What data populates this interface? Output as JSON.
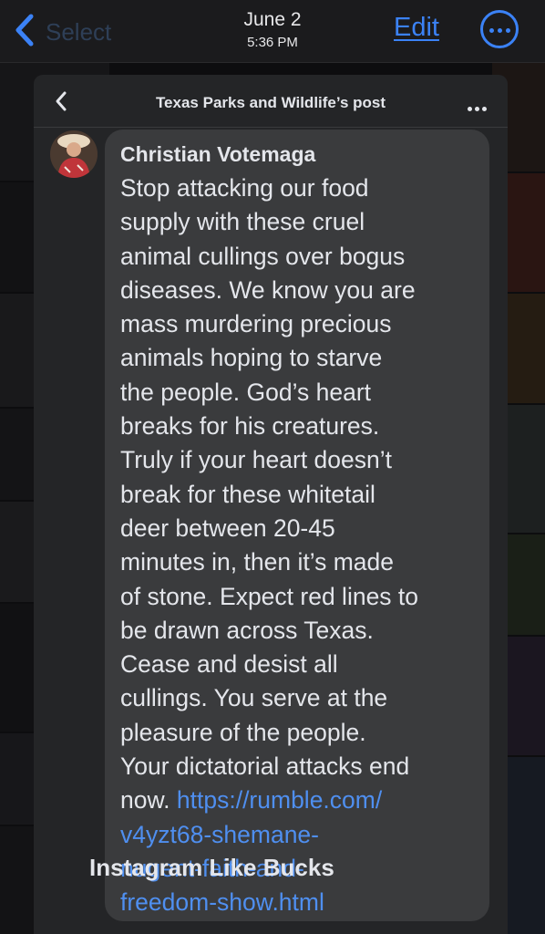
{
  "topbar": {
    "back_label": "Select",
    "date": "June 2",
    "time": "5:36 PM",
    "edit_label": "Edit",
    "more_icon": "more-circle-icon"
  },
  "post": {
    "header_title": "Texas Parks and Wildlife’s post",
    "back_icon": "chevron-left-icon",
    "menu_icon": "ellipsis-icon"
  },
  "comment": {
    "author": "Christian Votemaga",
    "lines": [
      "Stop attacking our food",
      "supply with these cruel",
      "animal cullings over bogus",
      "diseases. We know you are",
      "mass murdering precious",
      "animals hoping to starve",
      "the people. God’s heart",
      "breaks for his creatures.",
      "Truly if your heart doesn’t",
      "break for these whitetail",
      "deer between 20-45",
      "minutes in, then it’s made",
      "of stone. Expect red lines to",
      "be drawn across Texas.",
      "Cease and desist all",
      "cullings. You serve at the",
      "pleasure of the people.",
      "Your dictatorial attacks end"
    ],
    "last_text": "now. ",
    "link_lines": [
      "https://rumble.com/",
      "v4yzt68-shemane-",
      "nugent-faith-and-",
      "freedom-show.html"
    ]
  },
  "next_comment": {
    "author_partial": "Instagram Like Bucks"
  },
  "colors": {
    "accent": "#3b82f6",
    "link": "#4f8ff0",
    "bubble": "#3a3b3d",
    "panel": "#242527"
  }
}
